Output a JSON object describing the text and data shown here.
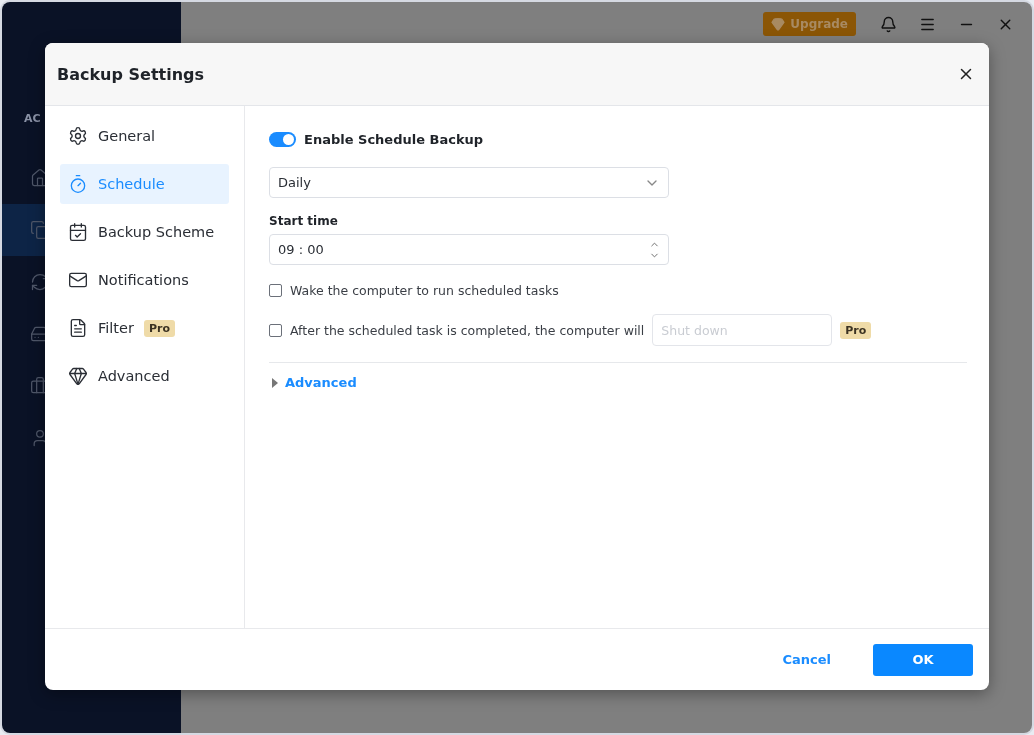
{
  "app": {
    "sidebar_label": "AC",
    "nav": [
      {
        "selected": false
      },
      {
        "selected": true
      },
      {
        "selected": false
      },
      {
        "selected": false
      },
      {
        "selected": false
      },
      {
        "selected": false
      }
    ],
    "upgrade_button": "Upgrade"
  },
  "dialog": {
    "title": "Backup Settings",
    "sidebar": [
      {
        "label": "General",
        "selected": false
      },
      {
        "label": "Schedule",
        "selected": true
      },
      {
        "label": "Backup Scheme",
        "selected": false
      },
      {
        "label": "Notifications",
        "selected": false
      },
      {
        "label": "Filter",
        "selected": false,
        "badge": "Pro"
      },
      {
        "label": "Advanced",
        "selected": false
      }
    ],
    "schedule": {
      "enable_toggle": {
        "label": "Enable Schedule Backup",
        "on": true
      },
      "frequency": "Daily",
      "start_time_label": "Start time",
      "start_time": "09 : 00",
      "wake_checkbox": {
        "label": "Wake the computer to run scheduled tasks",
        "checked": false
      },
      "after_checkbox": {
        "label": "After the scheduled task is completed, the computer will",
        "checked": false,
        "placeholder": "Shut down",
        "badge": "Pro"
      },
      "advanced": {
        "label": "Advanced",
        "expanded": false
      }
    },
    "buttons": {
      "cancel": "Cancel",
      "ok": "OK"
    }
  }
}
